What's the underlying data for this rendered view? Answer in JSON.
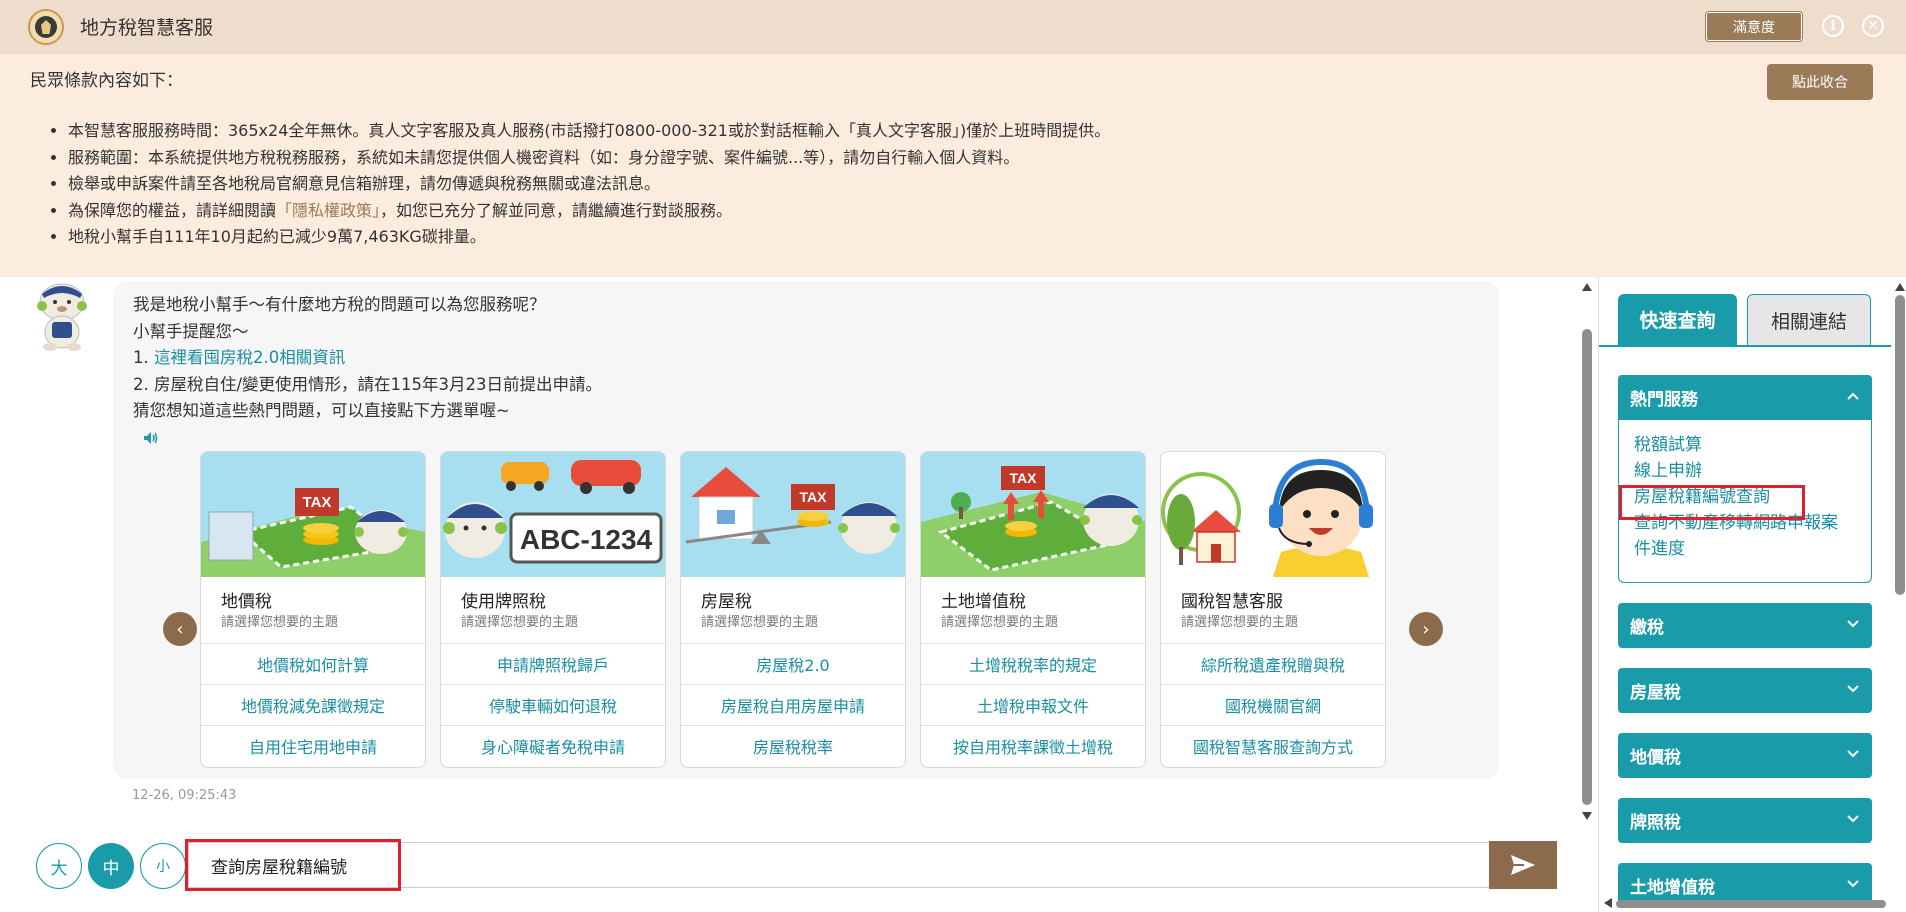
{
  "header": {
    "title": "地方稅智慧客服",
    "satisfaction_label": "滿意度",
    "info_label": "i",
    "close_label": "✕"
  },
  "terms": {
    "heading": "民眾條款內容如下：",
    "collapse_label": "點此收合",
    "items": [
      "本智慧客服服務時間：365x24全年無休。真人文字客服及真人服務(市話撥打0800-000-321或於對話框輸入「真人文字客服」)僅於上班時間提供。",
      "服務範圍：本系統提供地方稅稅務服務，系統如未請您提供個人機密資料（如：身分證字號、案件編號...等），請勿自行輸入個人資料。",
      "檢舉或申訴案件請至各地稅局官網意見信箱辦理，請勿傳遞與稅務無關或違法訊息。",
      "地稅小幫手自111年10月起約已減少9萬7,463KG碳排量。"
    ],
    "privacy_item": {
      "before": "為保障您的權益，請詳細閱讀",
      "link": "「隱私權政策」",
      "after": "，如您已充分了解並同意，請繼續進行對談服務。"
    }
  },
  "chat": {
    "greeting": "我是地稅小幫手～有什麼地方稅的問題可以為您服務呢？",
    "reminder": "小幫手提醒您～",
    "line1_prefix": "1. ",
    "line1_link": "這裡看囤房稅2.0相關資訊",
    "line2": "2. 房屋稅自住/變更使用情形，請在115年3月23日前提出申請。",
    "prompt": "猜您想知道這些熱門問題，可以直接點下方選單喔~",
    "timestamp": "12-26, 09:25:43",
    "cards": [
      {
        "title": "地價稅",
        "subtitle": "請選擇您想要的主題",
        "links": [
          "地價稅如何計算",
          "地價稅減免課徵規定",
          "自用住宅用地申請"
        ]
      },
      {
        "title": "使用牌照稅",
        "subtitle": "請選擇您想要的主題",
        "links": [
          "申請牌照稅歸戶",
          "停駛車輛如何退稅",
          "身心障礙者免稅申請"
        ]
      },
      {
        "title": "房屋稅",
        "subtitle": "請選擇您想要的主題",
        "links": [
          "房屋稅2.0",
          "房屋稅自用房屋申請",
          "房屋稅稅率"
        ]
      },
      {
        "title": "土地增值稅",
        "subtitle": "請選擇您想要的主題",
        "links": [
          "土增稅稅率的規定",
          "土增稅申報文件",
          "按自用稅率課徵土增稅"
        ]
      },
      {
        "title": "國稅智慧客服",
        "subtitle": "請選擇您想要的主題",
        "links": [
          "綜所稅遺產稅贈與稅",
          "國稅機關官網",
          "國稅智慧客服查詢方式"
        ]
      }
    ],
    "card_images": {
      "tax_sign": "TAX",
      "plate": "ABC-1234"
    }
  },
  "input": {
    "size_large": "大",
    "size_medium": "中",
    "size_small": "小",
    "value": "查詢房屋稅籍編號"
  },
  "sidebar": {
    "tab_quick": "快速查詢",
    "tab_links": "相關連結",
    "hot_services": {
      "title": "熱門服務",
      "links": [
        "稅額試算",
        "線上申辦",
        "房屋稅籍編號查詢",
        "查詢不動產移轉網路申報案件進度"
      ]
    },
    "sections": [
      "繳稅",
      "房屋稅",
      "地價稅",
      "牌照稅",
      "土地增值稅"
    ]
  },
  "colors": {
    "header_bg": "#eedccc",
    "terms_bg": "#fcecde",
    "accent_teal": "#1a9ba9",
    "accent_brown": "#8b6b4b",
    "highlight_red": "#e0202a"
  }
}
